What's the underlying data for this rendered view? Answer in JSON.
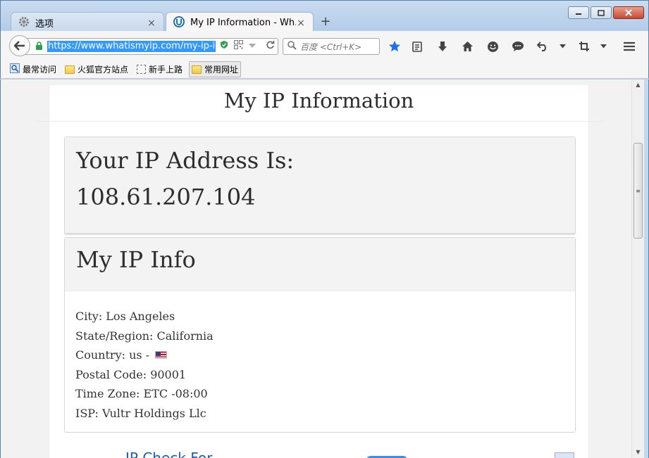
{
  "window": {
    "tabs": [
      {
        "label": "选项",
        "icon": "gear-icon"
      },
      {
        "label": "My IP Information - Wh...",
        "icon": "whatismyip-logo-icon"
      }
    ],
    "close_glyph": "×",
    "new_tab_glyph": "+"
  },
  "nav": {
    "url": "https://www.whatismyip.com/my-ip-i",
    "search_placeholder": "百度 <Ctrl+K>"
  },
  "bookmarks": [
    {
      "label": "最常访问"
    },
    {
      "label": "火狐官方站点"
    },
    {
      "label": "新手上路"
    },
    {
      "label": "常用网址"
    }
  ],
  "page": {
    "title": "My IP Information",
    "ip_heading": "Your IP Address Is:",
    "ip_value": "108.61.207.104",
    "info_heading": "My IP Info",
    "info": {
      "city": "City: Los Angeles",
      "state": "State/Region: California",
      "country": "Country: us -",
      "postal": "Postal Code: 90001",
      "timezone": "Time Zone: ETC -08:00",
      "isp": "ISP: Vultr Holdings Llc"
    },
    "ad_peek": "IP Check For"
  },
  "colors": {
    "accent": "#3399ff",
    "bookmark_star": "#1a73e8",
    "shield_green": "#2e9e4f"
  }
}
